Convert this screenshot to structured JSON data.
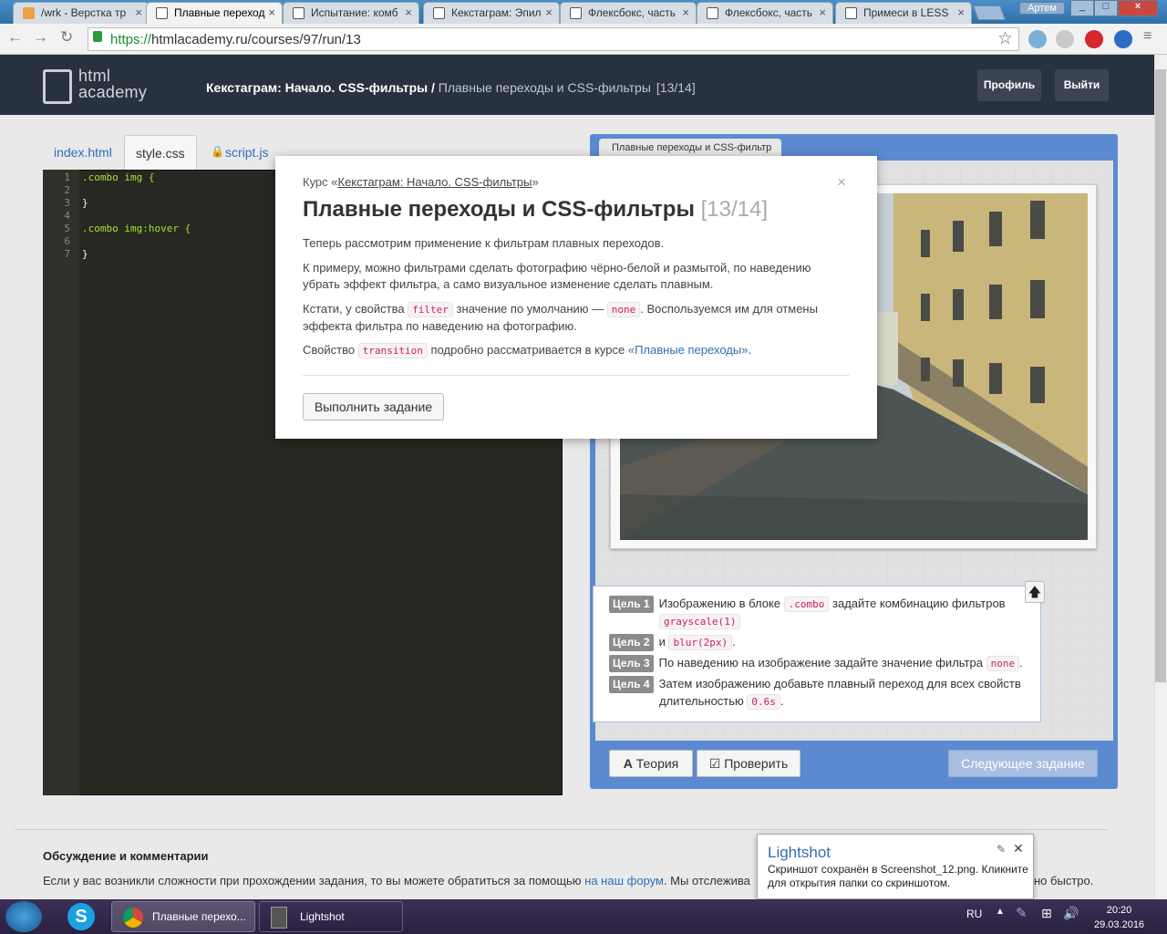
{
  "browser": {
    "tabs": [
      {
        "label": "/wrk - Верстка тр"
      },
      {
        "label": "Плавные переход"
      },
      {
        "label": "Испытание: комб"
      },
      {
        "label": "Кекстаграм: Эпил"
      },
      {
        "label": "Флексбокс, часть"
      },
      {
        "label": "Флексбокс, часть"
      },
      {
        "label": "Примеси в LESS"
      }
    ],
    "user": "Артем",
    "url_scheme": "https://",
    "url_rest": "htmlacademy.ru/courses/97/run/13"
  },
  "header": {
    "logo_line1": "html",
    "logo_line2": "academy",
    "crumb_course": "Кекстаграм: Начало. CSS-фильтры",
    "crumb_sep": " / ",
    "crumb_current": "Плавные переходы и CSS-фильтры",
    "progress": "[13/14]",
    "profile_label": "Профиль",
    "logout_label": "Выйти"
  },
  "editor": {
    "tabs": [
      "index.html",
      "style.css",
      "script.js"
    ],
    "line_numbers": "1\n2\n3\n4\n5\n6\n7",
    "code": [
      ".combo img {",
      "",
      "}",
      "",
      ".combo img:hover {",
      "",
      "}"
    ]
  },
  "preview": {
    "tab_label": "Плавные переходы и CSS-фильтр"
  },
  "goals": [
    {
      "label": "Цель 1",
      "text_before": "Изображению в блоке ",
      "code1": ".combo",
      "text_mid": " задайте комбинацию фильтров",
      "code2": "grayscale(1)"
    },
    {
      "label": "Цель 2",
      "text_before": "и ",
      "code1": "blur(2px)",
      "text_after": "."
    },
    {
      "label": "Цель 3",
      "text_before": "По наведению на изображение задайте значение фильтра ",
      "code1": "none",
      "text_after": "."
    },
    {
      "label": "Цель 4",
      "text_before": "Затем изображению добавьте плавный переход для всех свойств",
      "text_line2": "длительностью ",
      "code1": "0.6s",
      "text_after": "."
    }
  ],
  "panel_buttons": {
    "theory": "Теория",
    "theory_icon": "A",
    "check": "Проверить",
    "next": "Следующее задание"
  },
  "discussion": {
    "title": "Обсуждение и комментарии",
    "text_before": "Если у вас возникли сложности при прохождении задания, то вы можете обратиться за помощью ",
    "link": "на наш форум",
    "text_after": ". Мы отслежива",
    "text_tail": "но быстро."
  },
  "modal": {
    "course_prefix": "Курс «",
    "course_name": "Кекстаграм: Начало. CSS-фильтры",
    "course_suffix": "»",
    "title": "Плавные переходы и CSS-фильтры",
    "progress": "[13/14]",
    "p1": "Теперь рассмотрим применение к фильтрам плавных переходов.",
    "p2": "К примеру, можно фильтрами сделать фотографию чёрно-белой и размытой, по наведению убрать эффект фильтра, а само визуальное изменение сделать плавным.",
    "p3_a": "Кстати, у свойства ",
    "p3_code1": "filter",
    "p3_b": " значение по умолчанию — ",
    "p3_code2": "none",
    "p3_c": ". Воспользуемся им для отмены эффекта фильтра по наведению на фотографию.",
    "p4_a": "Свойство ",
    "p4_code": "transition",
    "p4_b": " подробно рассматривается в курсе ",
    "p4_link": "«Плавные переходы»",
    "p4_c": ".",
    "button": "Выполнить задание"
  },
  "toast": {
    "title": "Lightshot",
    "text": "Скриншот сохранён в Screenshot_12.png. Кликните для открытия папки со скриншотом."
  },
  "taskbar": {
    "items": [
      "Плавные перехо...",
      "Lightshot"
    ],
    "lang": "RU",
    "time": "20:20",
    "date": "29.03.2016"
  },
  "colors": {
    "accent": "#5c8ad0",
    "header_bg": "#283140",
    "link": "#2f6fb3"
  }
}
